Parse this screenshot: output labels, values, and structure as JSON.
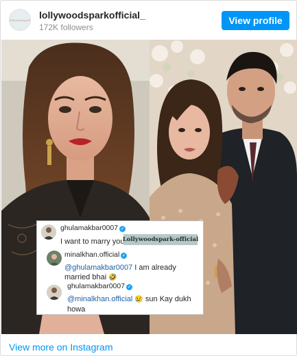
{
  "header": {
    "avatar_text": "lollywoodspark",
    "username": "lollywoodsparkofficial_",
    "followers": "172K followers",
    "view_profile_label": "View profile"
  },
  "colors": {
    "accent": "#0095f6",
    "link_mention": "#1e5fa3",
    "watermark_bg": "#b5c9ca"
  },
  "comments": [
    {
      "user": "ghulamakbar0007",
      "text": "I want to marry you"
    },
    {
      "user": "minalkhan.official",
      "mention": "@ghulamakbar0007",
      "text": " I am already married bhai",
      "emoji": "🤣"
    },
    {
      "user": "ghulamakbar0007",
      "mention": "@minalkhan.official",
      "emoji": "😢",
      "text": " sun Kay dukh howa"
    }
  ],
  "watermark": "Lollywoodspark-official",
  "footer": {
    "link_label": "View more on Instagram"
  }
}
